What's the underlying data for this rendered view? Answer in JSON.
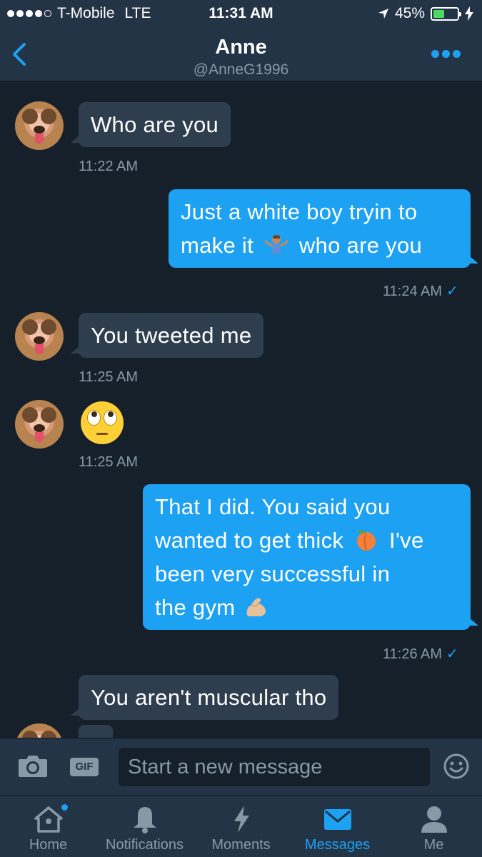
{
  "status_bar": {
    "carrier": "T-Mobile",
    "network": "LTE",
    "time": "11:31 AM",
    "battery_percent": "45%"
  },
  "header": {
    "name": "Anne",
    "handle": "@AnneG1996",
    "accent_color": "#1da1f2"
  },
  "messages": [
    {
      "direction": "incoming",
      "text": "Who are you",
      "time": "11:22 AM"
    },
    {
      "direction": "outgoing",
      "line1": "Just a white boy tryin to",
      "line2_before": "make it",
      "line2_emoji": "person-shrugging-emoji",
      "line2_after": "who are you",
      "time": "11:24 AM",
      "read": "✓"
    },
    {
      "direction": "incoming",
      "text": "You tweeted me",
      "time": "11:25 AM"
    },
    {
      "direction": "incoming",
      "emoji": "face-with-rolling-eyes-emoji",
      "time": "11:25 AM"
    },
    {
      "direction": "outgoing",
      "line1": "That I did. You said you",
      "line2_before": "wanted to get thick",
      "line2_emoji": "peach-emoji",
      "line2_after": "I've",
      "line3": "been very successful in",
      "line4": "the gym",
      "line4_emoji": "flexed-biceps-emoji",
      "time": "11:26 AM",
      "read": "✓"
    },
    {
      "direction": "incoming",
      "text": "You aren't muscular tho"
    }
  ],
  "compose": {
    "gif_label": "GIF",
    "placeholder": "Start a new message"
  },
  "tabs": [
    {
      "label": "Home",
      "icon": "home-icon",
      "badge": true
    },
    {
      "label": "Notifications",
      "icon": "bell-icon"
    },
    {
      "label": "Moments",
      "icon": "lightning-icon"
    },
    {
      "label": "Messages",
      "icon": "envelope-icon",
      "active": true
    },
    {
      "label": "Me",
      "icon": "person-icon"
    }
  ]
}
